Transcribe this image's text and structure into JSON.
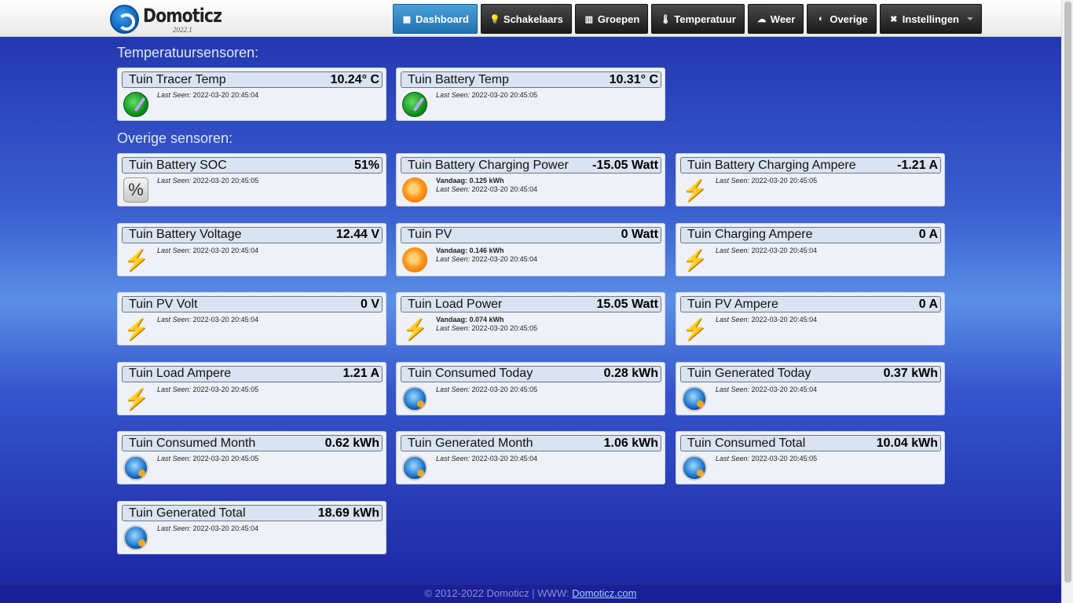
{
  "app": {
    "title": "Domoticz",
    "version": "2022.1"
  },
  "nav": [
    {
      "label": "Dashboard",
      "icon": "dashboard-icon",
      "active": true
    },
    {
      "label": "Schakelaars",
      "icon": "lightbulb-icon"
    },
    {
      "label": "Groepen",
      "icon": "groups-icon"
    },
    {
      "label": "Temperatuur",
      "icon": "thermometer-icon"
    },
    {
      "label": "Weer",
      "icon": "weather-icon"
    },
    {
      "label": "Overige",
      "icon": "other-icon"
    },
    {
      "label": "Instellingen",
      "icon": "tools-icon",
      "dropdown": true
    }
  ],
  "sections": {
    "temperature": "Temperatuursensoren:",
    "other": "Overige sensoren:"
  },
  "temp_cards": [
    {
      "name": "Tuin Tracer Temp",
      "value": "10.24° C",
      "last_seen": "2022-03-20 20:45:04"
    },
    {
      "name": "Tuin Battery Temp",
      "value": "10.31° C",
      "last_seen": "2022-03-20 20:45:05"
    }
  ],
  "labels": {
    "last_seen": "Last Seen:",
    "today": "Vandaag:"
  },
  "other_cards": [
    {
      "name": "Tuin Battery SOC",
      "value": "51%",
      "icon": "percent-icon",
      "last_seen": "2022-03-20 20:45:05"
    },
    {
      "name": "Tuin Battery Charging Power",
      "value": "-15.05 Watt",
      "icon": "sun-icon",
      "today": "0.125 kWh",
      "last_seen": "2022-03-20 20:45:04"
    },
    {
      "name": "Tuin Battery Charging Ampere",
      "value": "-1.21 A",
      "icon": "bolt-icon",
      "last_seen": "2022-03-20 20:45:05"
    },
    {
      "name": "Tuin Battery Voltage",
      "value": "12.44 V",
      "icon": "bolt-icon",
      "last_seen": "2022-03-20 20:45:04"
    },
    {
      "name": "Tuin PV",
      "value": "0 Watt",
      "icon": "sun-icon",
      "today": "0.146 kWh",
      "last_seen": "2022-03-20 20:45:04"
    },
    {
      "name": "Tuin Charging Ampere",
      "value": "0 A",
      "icon": "bolt-icon",
      "last_seen": "2022-03-20 20:45:04"
    },
    {
      "name": "Tuin PV Volt",
      "value": "0 V",
      "icon": "bolt-icon",
      "last_seen": "2022-03-20 20:45:04"
    },
    {
      "name": "Tuin Load Power",
      "value": "15.05 Watt",
      "icon": "bolt-icon",
      "today": "0.074 kWh",
      "last_seen": "2022-03-20 20:45:05"
    },
    {
      "name": "Tuin PV Ampere",
      "value": "0 A",
      "icon": "bolt-icon",
      "last_seen": "2022-03-20 20:45:04"
    },
    {
      "name": "Tuin Load Ampere",
      "value": "1.21 A",
      "icon": "bolt-icon",
      "last_seen": "2022-03-20 20:45:05"
    },
    {
      "name": "Tuin Consumed Today",
      "value": "0.28 kWh",
      "icon": "globe-icon",
      "last_seen": "2022-03-20 20:45:05"
    },
    {
      "name": "Tuin Generated Today",
      "value": "0.37 kWh",
      "icon": "globe-icon",
      "last_seen": "2022-03-20 20:45:04"
    },
    {
      "name": "Tuin Consumed Month",
      "value": "0.62 kWh",
      "icon": "globe-icon",
      "last_seen": "2022-03-20 20:45:05"
    },
    {
      "name": "Tuin Generated Month",
      "value": "1.06 kWh",
      "icon": "globe-icon",
      "last_seen": "2022-03-20 20:45:04"
    },
    {
      "name": "Tuin Consumed Total",
      "value": "10.04 kWh",
      "icon": "globe-icon",
      "last_seen": "2022-03-20 20:45:05"
    },
    {
      "name": "Tuin Generated Total",
      "value": "18.69 kWh",
      "icon": "globe-icon",
      "last_seen": "2022-03-20 20:45:04"
    }
  ],
  "footer": {
    "text": "© 2012-2022 Domoticz | WWW: ",
    "link": "Domoticz.com"
  }
}
